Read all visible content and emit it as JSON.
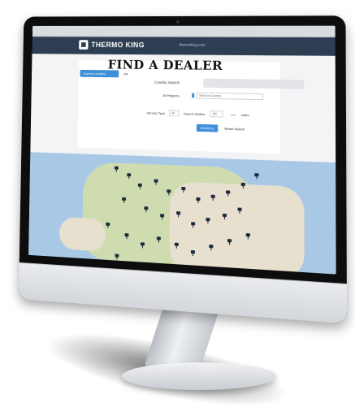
{
  "header": {
    "logo_text": "THERMO KING",
    "link_text": "thermoking.com"
  },
  "main": {
    "title": "FIND A DEALER",
    "current_location_label": "Current Location",
    "or_label": "OR",
    "tabs": [
      {
        "label": "Country Search"
      },
      {
        "label": ""
      }
    ],
    "regions_label": "All Regions",
    "country_placeholder": "Select a Country",
    "service_type_label": "Service Type",
    "service_type_value": "All",
    "search_radius_label": "Search Radius",
    "search_radius_value": "250",
    "unit_km": "km",
    "unit_miles": "miles",
    "search_button": "SEARCH",
    "reset_label": "Reset Search"
  },
  "colors": {
    "header_bg": "#2d3e52",
    "accent": "#3c8fd8",
    "map_water": "#a9c8e6",
    "map_land": "#e8e0cf"
  },
  "icons": {
    "logo": "thermo-king-logo-icon",
    "location": "location-icon",
    "marker": "dealer-marker-icon"
  }
}
